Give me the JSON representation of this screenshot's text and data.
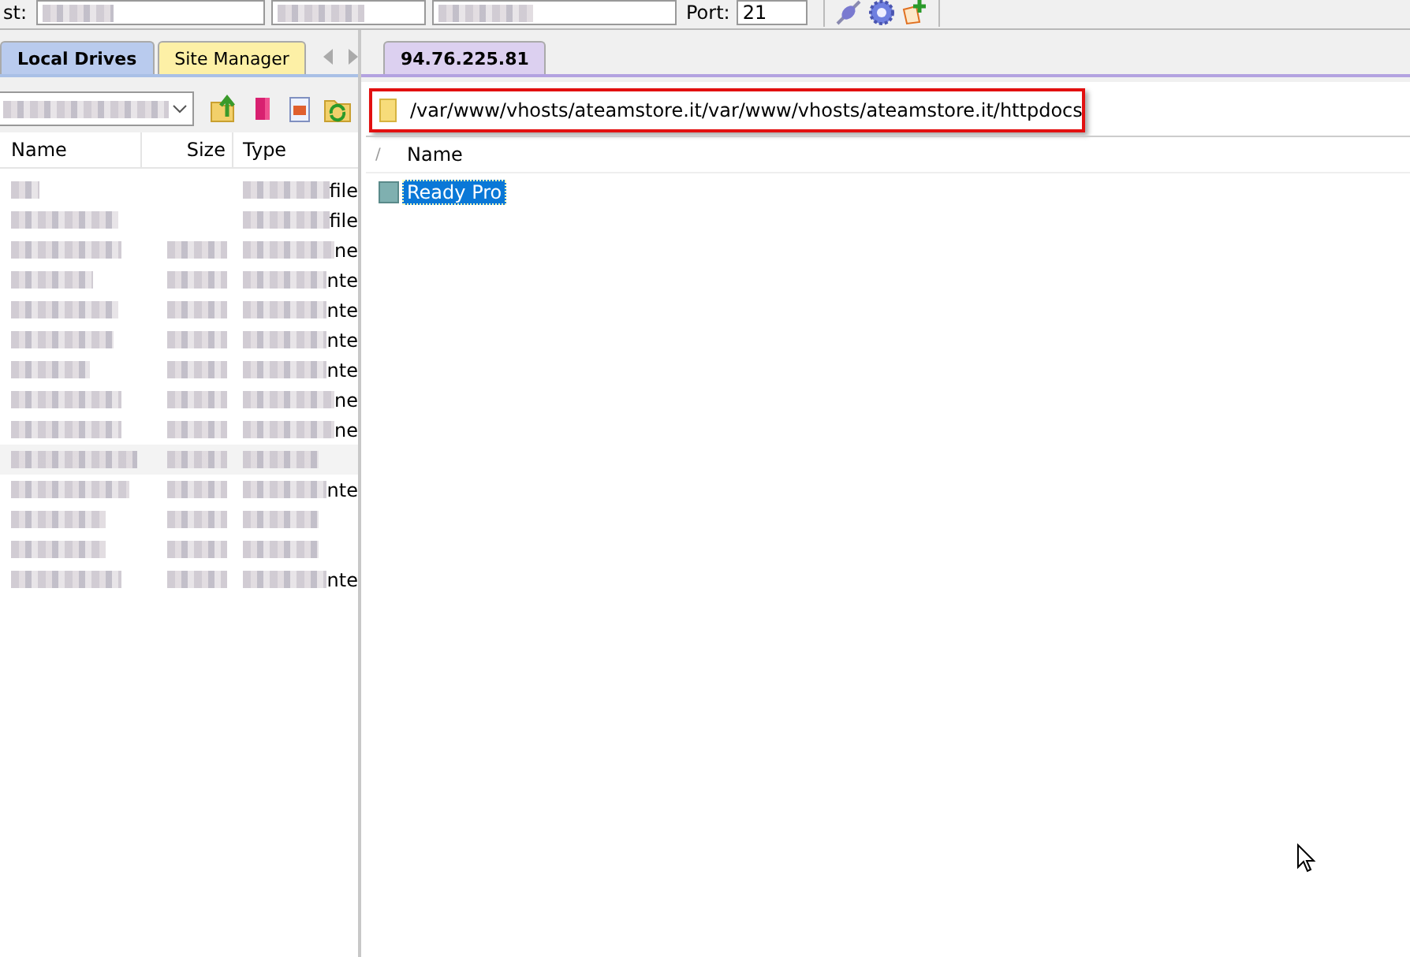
{
  "toolbar": {
    "host_label": "st:",
    "port_label": "Port:",
    "port_value": "21"
  },
  "left_tabs": [
    {
      "label": "Local Drives",
      "selected": true
    },
    {
      "label": "Site Manager",
      "selected": false
    }
  ],
  "right_tabs": [
    {
      "label": "94.76.225.81",
      "selected": true
    }
  ],
  "local_list": {
    "columns": [
      "Name",
      "Size",
      "Type"
    ],
    "rows": [
      {
        "type_tail": "file"
      },
      {
        "type_tail": "file"
      },
      {
        "type_tail": "ne"
      },
      {
        "type_tail": "nte"
      },
      {
        "type_tail": "nte"
      },
      {
        "type_tail": "nte"
      },
      {
        "type_tail": "nte"
      },
      {
        "type_tail": "ne"
      },
      {
        "type_tail": "ne"
      },
      {
        "selected": true
      },
      {
        "type_tail": "nte"
      },
      {},
      {},
      {
        "type_tail": "nte"
      }
    ]
  },
  "remote": {
    "path": "/var/www/vhosts/ateamstore.it/var/www/vhosts/ateamstore.it/httpdocs",
    "path_highlighted": true,
    "columns": [
      "/",
      "Name"
    ],
    "rows": [
      {
        "name": "Ready Pro",
        "selected": true
      }
    ]
  }
}
